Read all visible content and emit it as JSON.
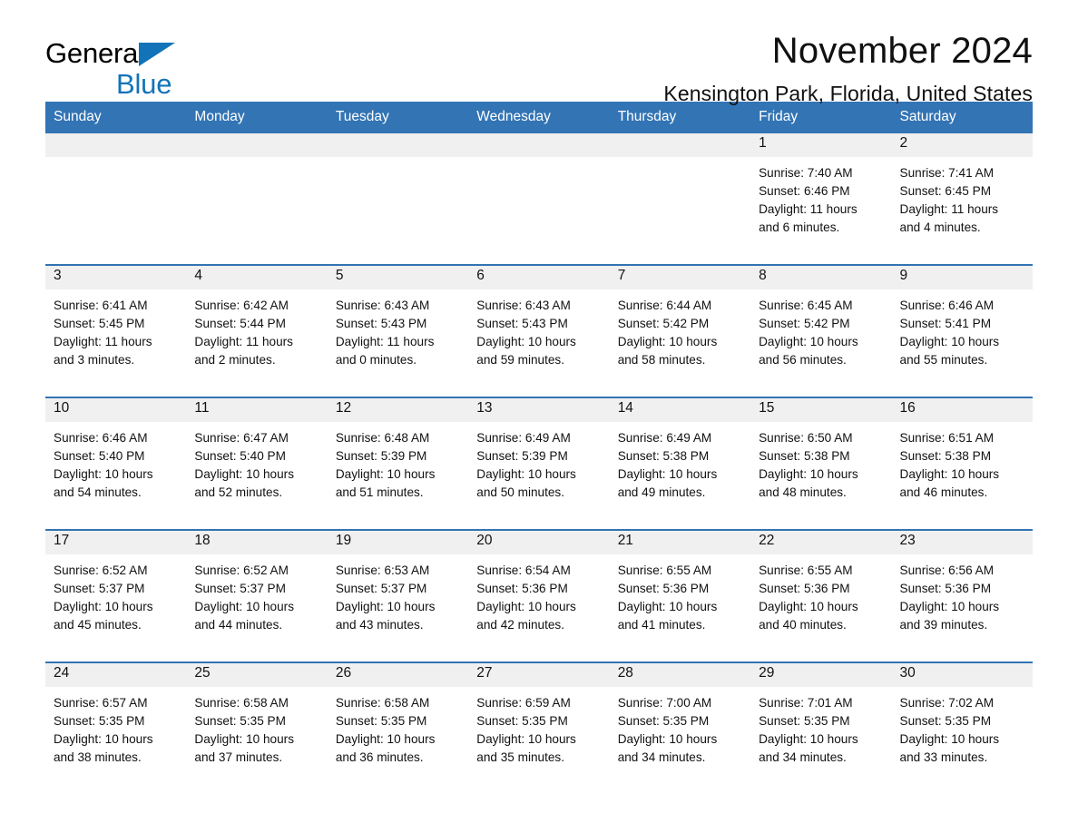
{
  "brand": {
    "name_part1": "General",
    "name_part2": "Blue",
    "accent_color": "#1273b8"
  },
  "header": {
    "title": "November 2024",
    "subtitle": "Kensington Park, Florida, United States"
  },
  "calendar": {
    "header_bg": "#3274b4",
    "daynum_bg": "#f0f0f0",
    "weekday_labels": [
      "Sunday",
      "Monday",
      "Tuesday",
      "Wednesday",
      "Thursday",
      "Friday",
      "Saturday"
    ],
    "weeks": [
      [
        {
          "day": "",
          "sunrise": "",
          "sunset": "",
          "daylight_line1": "",
          "daylight_line2": ""
        },
        {
          "day": "",
          "sunrise": "",
          "sunset": "",
          "daylight_line1": "",
          "daylight_line2": ""
        },
        {
          "day": "",
          "sunrise": "",
          "sunset": "",
          "daylight_line1": "",
          "daylight_line2": ""
        },
        {
          "day": "",
          "sunrise": "",
          "sunset": "",
          "daylight_line1": "",
          "daylight_line2": ""
        },
        {
          "day": "",
          "sunrise": "",
          "sunset": "",
          "daylight_line1": "",
          "daylight_line2": ""
        },
        {
          "day": "1",
          "sunrise": "Sunrise: 7:40 AM",
          "sunset": "Sunset: 6:46 PM",
          "daylight_line1": "Daylight: 11 hours",
          "daylight_line2": "and 6 minutes."
        },
        {
          "day": "2",
          "sunrise": "Sunrise: 7:41 AM",
          "sunset": "Sunset: 6:45 PM",
          "daylight_line1": "Daylight: 11 hours",
          "daylight_line2": "and 4 minutes."
        }
      ],
      [
        {
          "day": "3",
          "sunrise": "Sunrise: 6:41 AM",
          "sunset": "Sunset: 5:45 PM",
          "daylight_line1": "Daylight: 11 hours",
          "daylight_line2": "and 3 minutes."
        },
        {
          "day": "4",
          "sunrise": "Sunrise: 6:42 AM",
          "sunset": "Sunset: 5:44 PM",
          "daylight_line1": "Daylight: 11 hours",
          "daylight_line2": "and 2 minutes."
        },
        {
          "day": "5",
          "sunrise": "Sunrise: 6:43 AM",
          "sunset": "Sunset: 5:43 PM",
          "daylight_line1": "Daylight: 11 hours",
          "daylight_line2": "and 0 minutes."
        },
        {
          "day": "6",
          "sunrise": "Sunrise: 6:43 AM",
          "sunset": "Sunset: 5:43 PM",
          "daylight_line1": "Daylight: 10 hours",
          "daylight_line2": "and 59 minutes."
        },
        {
          "day": "7",
          "sunrise": "Sunrise: 6:44 AM",
          "sunset": "Sunset: 5:42 PM",
          "daylight_line1": "Daylight: 10 hours",
          "daylight_line2": "and 58 minutes."
        },
        {
          "day": "8",
          "sunrise": "Sunrise: 6:45 AM",
          "sunset": "Sunset: 5:42 PM",
          "daylight_line1": "Daylight: 10 hours",
          "daylight_line2": "and 56 minutes."
        },
        {
          "day": "9",
          "sunrise": "Sunrise: 6:46 AM",
          "sunset": "Sunset: 5:41 PM",
          "daylight_line1": "Daylight: 10 hours",
          "daylight_line2": "and 55 minutes."
        }
      ],
      [
        {
          "day": "10",
          "sunrise": "Sunrise: 6:46 AM",
          "sunset": "Sunset: 5:40 PM",
          "daylight_line1": "Daylight: 10 hours",
          "daylight_line2": "and 54 minutes."
        },
        {
          "day": "11",
          "sunrise": "Sunrise: 6:47 AM",
          "sunset": "Sunset: 5:40 PM",
          "daylight_line1": "Daylight: 10 hours",
          "daylight_line2": "and 52 minutes."
        },
        {
          "day": "12",
          "sunrise": "Sunrise: 6:48 AM",
          "sunset": "Sunset: 5:39 PM",
          "daylight_line1": "Daylight: 10 hours",
          "daylight_line2": "and 51 minutes."
        },
        {
          "day": "13",
          "sunrise": "Sunrise: 6:49 AM",
          "sunset": "Sunset: 5:39 PM",
          "daylight_line1": "Daylight: 10 hours",
          "daylight_line2": "and 50 minutes."
        },
        {
          "day": "14",
          "sunrise": "Sunrise: 6:49 AM",
          "sunset": "Sunset: 5:38 PM",
          "daylight_line1": "Daylight: 10 hours",
          "daylight_line2": "and 49 minutes."
        },
        {
          "day": "15",
          "sunrise": "Sunrise: 6:50 AM",
          "sunset": "Sunset: 5:38 PM",
          "daylight_line1": "Daylight: 10 hours",
          "daylight_line2": "and 48 minutes."
        },
        {
          "day": "16",
          "sunrise": "Sunrise: 6:51 AM",
          "sunset": "Sunset: 5:38 PM",
          "daylight_line1": "Daylight: 10 hours",
          "daylight_line2": "and 46 minutes."
        }
      ],
      [
        {
          "day": "17",
          "sunrise": "Sunrise: 6:52 AM",
          "sunset": "Sunset: 5:37 PM",
          "daylight_line1": "Daylight: 10 hours",
          "daylight_line2": "and 45 minutes."
        },
        {
          "day": "18",
          "sunrise": "Sunrise: 6:52 AM",
          "sunset": "Sunset: 5:37 PM",
          "daylight_line1": "Daylight: 10 hours",
          "daylight_line2": "and 44 minutes."
        },
        {
          "day": "19",
          "sunrise": "Sunrise: 6:53 AM",
          "sunset": "Sunset: 5:37 PM",
          "daylight_line1": "Daylight: 10 hours",
          "daylight_line2": "and 43 minutes."
        },
        {
          "day": "20",
          "sunrise": "Sunrise: 6:54 AM",
          "sunset": "Sunset: 5:36 PM",
          "daylight_line1": "Daylight: 10 hours",
          "daylight_line2": "and 42 minutes."
        },
        {
          "day": "21",
          "sunrise": "Sunrise: 6:55 AM",
          "sunset": "Sunset: 5:36 PM",
          "daylight_line1": "Daylight: 10 hours",
          "daylight_line2": "and 41 minutes."
        },
        {
          "day": "22",
          "sunrise": "Sunrise: 6:55 AM",
          "sunset": "Sunset: 5:36 PM",
          "daylight_line1": "Daylight: 10 hours",
          "daylight_line2": "and 40 minutes."
        },
        {
          "day": "23",
          "sunrise": "Sunrise: 6:56 AM",
          "sunset": "Sunset: 5:36 PM",
          "daylight_line1": "Daylight: 10 hours",
          "daylight_line2": "and 39 minutes."
        }
      ],
      [
        {
          "day": "24",
          "sunrise": "Sunrise: 6:57 AM",
          "sunset": "Sunset: 5:35 PM",
          "daylight_line1": "Daylight: 10 hours",
          "daylight_line2": "and 38 minutes."
        },
        {
          "day": "25",
          "sunrise": "Sunrise: 6:58 AM",
          "sunset": "Sunset: 5:35 PM",
          "daylight_line1": "Daylight: 10 hours",
          "daylight_line2": "and 37 minutes."
        },
        {
          "day": "26",
          "sunrise": "Sunrise: 6:58 AM",
          "sunset": "Sunset: 5:35 PM",
          "daylight_line1": "Daylight: 10 hours",
          "daylight_line2": "and 36 minutes."
        },
        {
          "day": "27",
          "sunrise": "Sunrise: 6:59 AM",
          "sunset": "Sunset: 5:35 PM",
          "daylight_line1": "Daylight: 10 hours",
          "daylight_line2": "and 35 minutes."
        },
        {
          "day": "28",
          "sunrise": "Sunrise: 7:00 AM",
          "sunset": "Sunset: 5:35 PM",
          "daylight_line1": "Daylight: 10 hours",
          "daylight_line2": "and 34 minutes."
        },
        {
          "day": "29",
          "sunrise": "Sunrise: 7:01 AM",
          "sunset": "Sunset: 5:35 PM",
          "daylight_line1": "Daylight: 10 hours",
          "daylight_line2": "and 34 minutes."
        },
        {
          "day": "30",
          "sunrise": "Sunrise: 7:02 AM",
          "sunset": "Sunset: 5:35 PM",
          "daylight_line1": "Daylight: 10 hours",
          "daylight_line2": "and 33 minutes."
        }
      ]
    ]
  }
}
